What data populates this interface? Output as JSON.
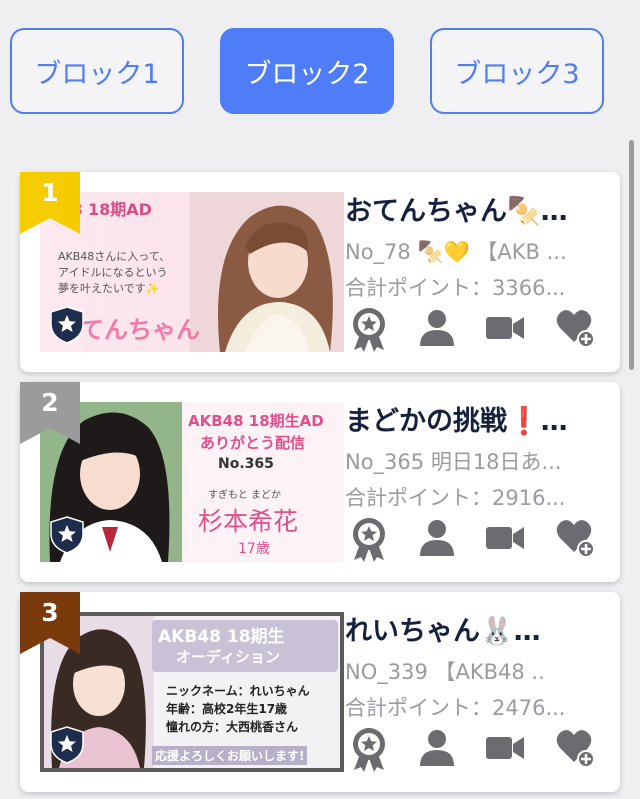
{
  "blocks": [
    {
      "label": "ブロック1",
      "active": false
    },
    {
      "label": "ブロック2",
      "active": true
    },
    {
      "label": "ブロック3",
      "active": false
    }
  ],
  "colors": {
    "accent": "#4f7cf7",
    "rank_1": "#f5cc00",
    "rank_2": "#9b9b9b",
    "rank_3": "#7a3a0c",
    "icon_gray": "#6c6c70",
    "name_text": "#16213e",
    "sub_text": "#9a9aa0"
  },
  "cards": [
    {
      "rank": "1",
      "name": "おてんちゃん🍢…",
      "detail": "No_78 🍢💛 【AKB ...",
      "points": "合計ポイント：3366...",
      "thumb": {
        "lines": [
          "B48  18期AD",
          "AKB48さんに入って、",
          "アイドルになるという",
          "夢を叶えたいです✨",
          "てんちゃん"
        ]
      }
    },
    {
      "rank": "2",
      "name": "まどかの挑戦❗…",
      "detail": "No_365 明日18日あ...",
      "points": "合計ポイント：2916...",
      "thumb": {
        "lines": [
          "AKB48 18期生AD",
          "ありがとう配信",
          "No.365",
          "すぎもと  まどか",
          "杉本希花",
          "17歳"
        ]
      }
    },
    {
      "rank": "3",
      "name": "れいちゃん🐰…",
      "detail": "NO_339  【AKB48    ..",
      "points": "合計ポイント：2476...",
      "thumb": {
        "lines": [
          "AKB48 18期生",
          "オーディション",
          "ニックネーム：れいちゃん",
          "年齢：高校2年生17歳",
          "憧れの方：大西桃香さん",
          "応援よろしくお願いします!"
        ]
      }
    }
  ],
  "icons": [
    "award-icon",
    "person-icon",
    "video-camera-icon",
    "heart-plus-icon"
  ]
}
